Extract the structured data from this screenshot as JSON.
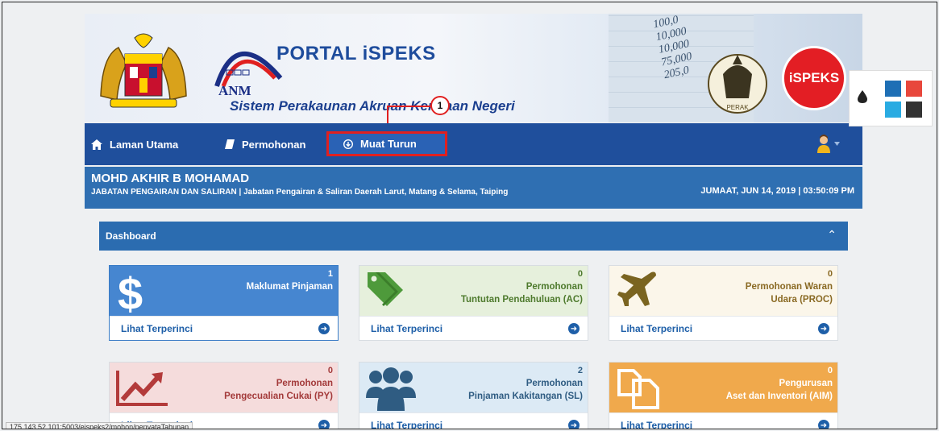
{
  "banner": {
    "portal_title": "PORTAL iSPEKS",
    "subtitle": "Sistem Perakaunan Akruan Kerajaan Negeri",
    "anm_text": "ANM",
    "ispeks_logo": "iSPEKS",
    "perak_text": "PERAK",
    "ledger_numbers": [
      "100,0",
      "10,000",
      "10,000",
      "75,000",
      "205,0"
    ]
  },
  "callout": {
    "number": "1",
    "color": "#e02020"
  },
  "navbar": {
    "items": [
      {
        "label": "Laman Utama",
        "icon": "home-icon"
      },
      {
        "label": "Permohonan",
        "icon": "book-icon"
      },
      {
        "label": "Muat Turun",
        "icon": "download-icon"
      }
    ],
    "user_icon": "user-avatar-icon"
  },
  "user": {
    "name": "MOHD AKHIR B MOHAMAD",
    "department": "JABATAN PENGAIRAN DAN SALIRAN | Jabatan Pengairan & Saliran Daerah Larut, Matang & Selama, Taiping",
    "datetime": "JUMAAT, JUN 14, 2019 | 03:50:09 PM"
  },
  "dashboard": {
    "title": "Dashboard",
    "cards": [
      {
        "count": "1",
        "label_line1": "Maklumat Pinjaman",
        "label_line2": "",
        "link": "Lihat Terperinci",
        "icon": "dollar-icon"
      },
      {
        "count": "0",
        "label_line1": "Permohonan",
        "label_line2": "Tuntutan Pendahuluan (AC)",
        "link": "Lihat Terperinci",
        "icon": "tags-icon"
      },
      {
        "count": "0",
        "label_line1": "Permohonan Waran",
        "label_line2": "Udara (PROC)",
        "link": "Lihat Terperinci",
        "icon": "plane-icon"
      },
      {
        "count": "0",
        "label_line1": "Permohonan",
        "label_line2": "Pengecualian Cukai (PY)",
        "link": "Lihat Terperinci",
        "icon": "chart-up-icon"
      },
      {
        "count": "2",
        "label_line1": "Permohonan",
        "label_line2": "Pinjaman Kakitangan (SL)",
        "link": "Lihat Terperinci",
        "icon": "users-icon"
      },
      {
        "count": "0",
        "label_line1": "Pengurusan",
        "label_line2": "Aset dan Inventori (AIM)",
        "link": "Lihat Terperinci",
        "icon": "copy-icon"
      }
    ]
  },
  "theme_colors": [
    "#1e6fb5",
    "#e8473c",
    "#29abe2",
    "#333333"
  ],
  "status_url": "175.143.52.101:5003/eispeks2/mohon/penyataTahunan"
}
